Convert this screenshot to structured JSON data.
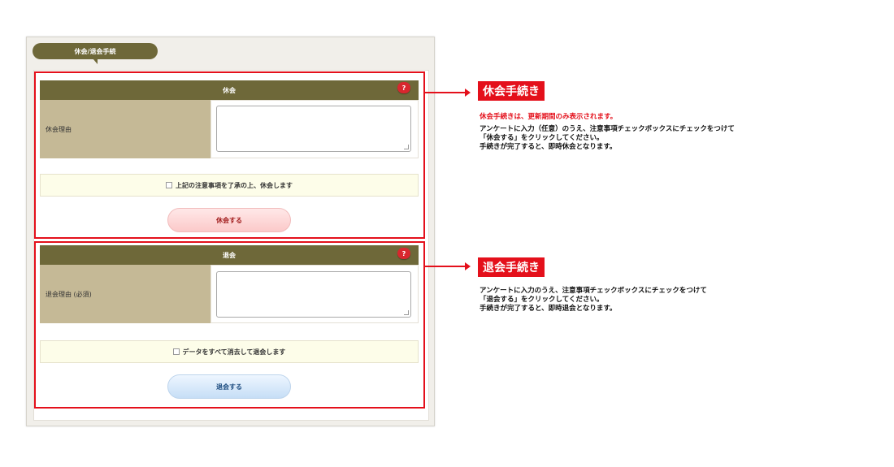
{
  "panel": {
    "title": "休会/退会手続"
  },
  "suspend": {
    "header": "休会",
    "help": "?",
    "reason_label": "休会理由",
    "reason_value": "",
    "notice": "上記の注意事項を了承の上、休会します",
    "button": "休会する"
  },
  "withdraw": {
    "header": "退会",
    "help": "?",
    "reason_label": "退会理由 (必須)",
    "reason_value": "",
    "notice": "データをすべて消去して退会します",
    "button": "退会する"
  },
  "callouts": {
    "suspend": {
      "title": "休会手続き",
      "warning": "休会手続きは、更新期間のみ表示されます。",
      "body": "アンケートに入力（任意）のうえ、注意事項チェックボックスにチェックをつけて\n「休会する」をクリックしてください。\n手続きが完了すると、即時休会となります。"
    },
    "withdraw": {
      "title": "退会手続き",
      "body": "アンケートに入力のうえ、注意事項チェックボックスにチェックをつけて\n「退会する」をクリックしてください。\n手続きが完了すると、即時退会となります。"
    }
  },
  "colors": {
    "header_bg": "#6e6839",
    "label_bg": "#c5b996",
    "highlight_red": "#e4101b"
  }
}
